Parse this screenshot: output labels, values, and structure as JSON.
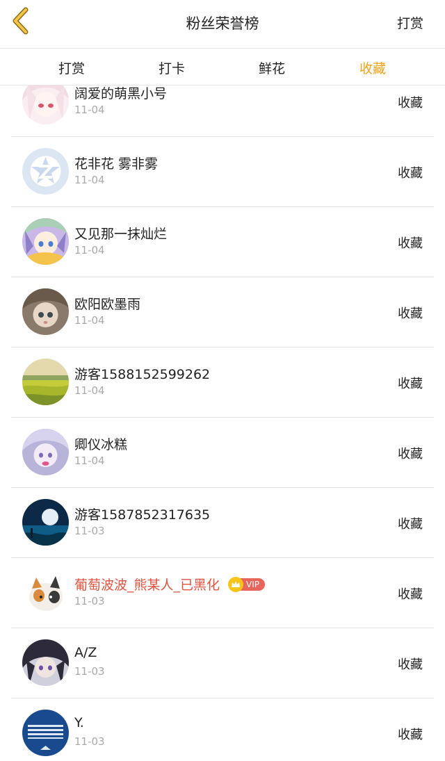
{
  "header": {
    "title": "粉丝荣誉榜",
    "action_label": "打赏"
  },
  "tabs": [
    {
      "label": "打赏",
      "active": false
    },
    {
      "label": "打卡",
      "active": false
    },
    {
      "label": "鲜花",
      "active": false
    },
    {
      "label": "收藏",
      "active": true
    }
  ],
  "colors": {
    "accent": "#f0a21a",
    "vip_name": "#e0533f",
    "date_gray": "#a9a9a9"
  },
  "list": [
    {
      "name": "阔爱的萌黑小号",
      "date": "11-04",
      "action": "收藏",
      "avatar": "anime-pink-hair-avatar"
    },
    {
      "name": "花非花 雾非雾",
      "date": "11-04",
      "action": "收藏",
      "avatar": "default-z-avatar"
    },
    {
      "name": "又见那一抹灿烂",
      "date": "11-04",
      "action": "收藏",
      "avatar": "anime-green-hair-avatar"
    },
    {
      "name": "欧阳欧墨雨",
      "date": "11-04",
      "action": "收藏",
      "avatar": "doll-avatar"
    },
    {
      "name": "游客1588152599262",
      "date": "11-04",
      "action": "收藏",
      "avatar": "field-landscape-avatar"
    },
    {
      "name": "卿仪冰糕",
      "date": "11-04",
      "action": "收藏",
      "avatar": "anime-purple-avatar"
    },
    {
      "name": "游客1587852317635",
      "date": "11-03",
      "action": "收藏",
      "avatar": "moon-night-avatar"
    },
    {
      "name": "葡萄波波_熊某人_已黑化",
      "date": "11-03",
      "action": "收藏",
      "avatar": "cat-avatar",
      "vip": true,
      "vip_label": "VIP"
    },
    {
      "name": "A/Z",
      "date": "11-03",
      "action": "收藏",
      "avatar": "anime-dark-hair-avatar"
    },
    {
      "name": "Y.",
      "date": "11-03",
      "action": "收藏",
      "avatar": "blue-stripes-avatar"
    }
  ]
}
